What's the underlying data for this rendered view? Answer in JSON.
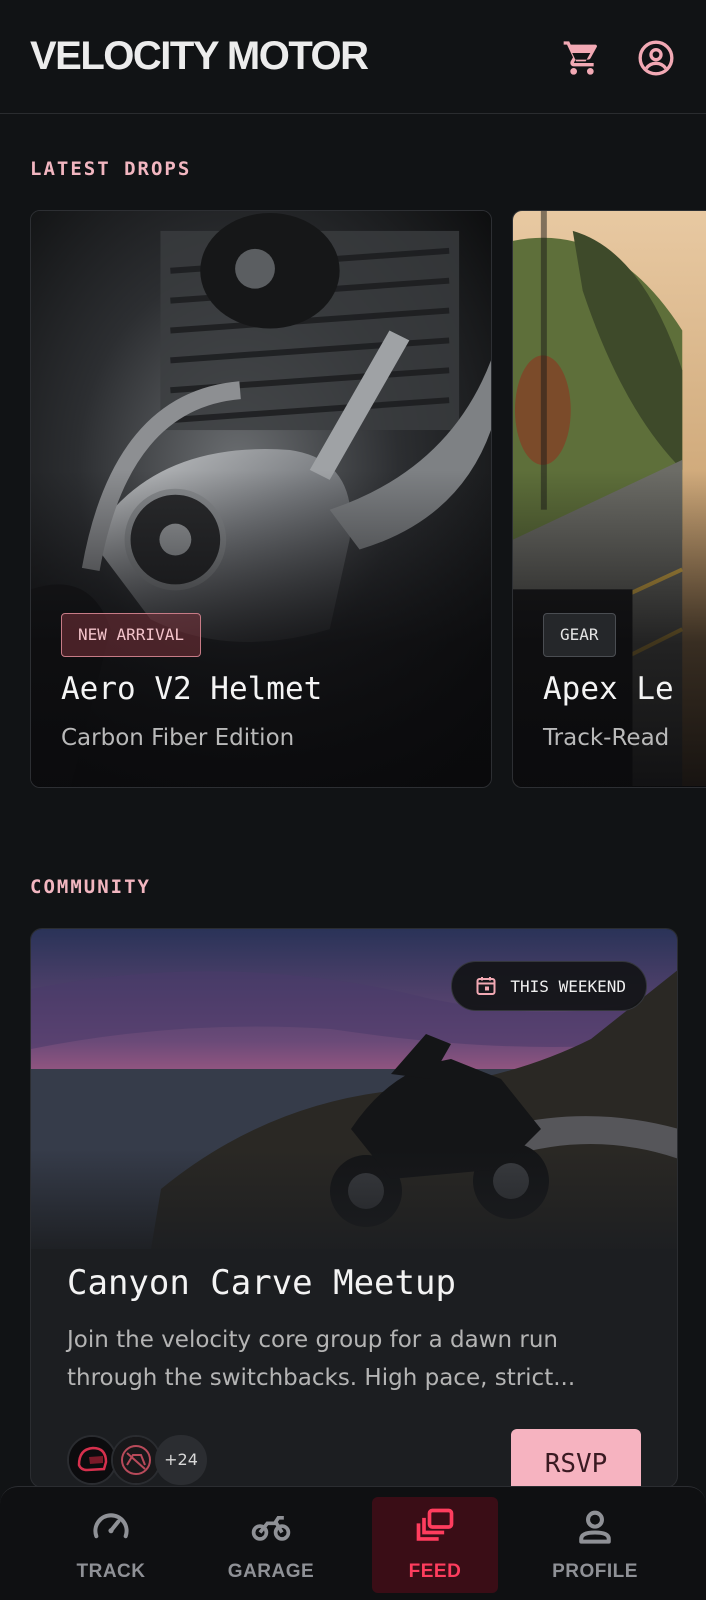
{
  "header": {
    "brand": "VELOCITY MOTOR",
    "cart_icon": "shopping-cart-icon",
    "account_icon": "account-circle-icon"
  },
  "drops": {
    "label": "LATEST DROPS",
    "items": [
      {
        "tag": "NEW ARRIVAL",
        "title": "Aero V2 Helmet",
        "subtitle": "Carbon Fiber Edition"
      },
      {
        "tag": "GEAR",
        "title": "Apex Le",
        "subtitle": "Track-Read"
      }
    ]
  },
  "community": {
    "label": "COMMUNITY",
    "event": {
      "badge": "THIS WEEKEND",
      "title": "Canyon Carve Meetup",
      "description": "Join the velocity core group for a dawn run through the switchbacks. High pace, strict...",
      "attendee_count": "+24",
      "rsvp_label": "RSVP"
    }
  },
  "nav": {
    "items": [
      {
        "label": "TRACK",
        "icon": "speedometer-icon"
      },
      {
        "label": "GARAGE",
        "icon": "motorcycle-icon"
      },
      {
        "label": "FEED",
        "icon": "stacked-cards-icon",
        "active": true
      },
      {
        "label": "PROFILE",
        "icon": "person-icon"
      }
    ]
  },
  "colors": {
    "accent": "#f2b6c0",
    "active": "#ff3d5e",
    "background": "#111315"
  }
}
